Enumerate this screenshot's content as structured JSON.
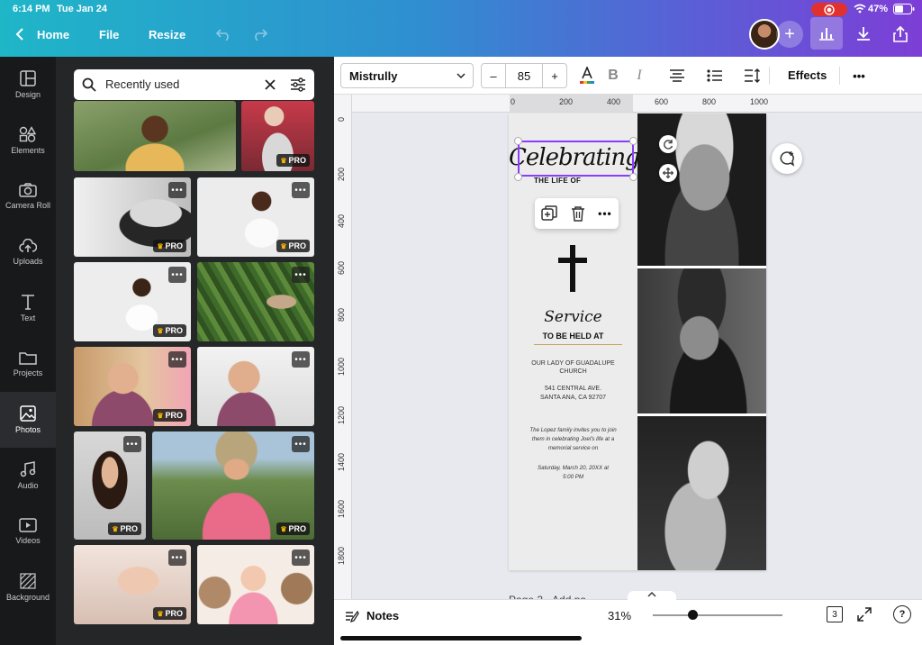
{
  "status_bar": {
    "time": "6:14 PM",
    "date": "Tue Jan 24",
    "battery": "47%"
  },
  "nav": {
    "home": "Home",
    "file": "File",
    "resize": "Resize"
  },
  "rail": {
    "items": [
      {
        "label": "Design",
        "icon": "layout-icon"
      },
      {
        "label": "Elements",
        "icon": "shapes-icon"
      },
      {
        "label": "Camera Roll",
        "icon": "camera-icon"
      },
      {
        "label": "Uploads",
        "icon": "cloud-upload-icon"
      },
      {
        "label": "Text",
        "icon": "text-icon"
      },
      {
        "label": "Projects",
        "icon": "folder-icon"
      },
      {
        "label": "Photos",
        "icon": "image-icon",
        "active": true
      },
      {
        "label": "Audio",
        "icon": "music-icon"
      },
      {
        "label": "Videos",
        "icon": "video-icon"
      },
      {
        "label": "Background",
        "icon": "pattern-icon"
      }
    ]
  },
  "search": {
    "value": "Recently used"
  },
  "photos": {
    "pro_label": "PRO",
    "more_label": "•••"
  },
  "toolbar": {
    "font": "Mistrully",
    "size_minus": "–",
    "font_size": "85",
    "size_plus": "+",
    "bold": "B",
    "italic": "I",
    "effects": "Effects",
    "more": "•••"
  },
  "ruler": {
    "h_ticks": [
      "0",
      "200",
      "400",
      "600",
      "800",
      "1000"
    ],
    "v_ticks": [
      "0",
      "200",
      "400",
      "600",
      "800",
      "1000",
      "1200",
      "1400",
      "1600",
      "1800"
    ]
  },
  "design": {
    "title_script": "Celebrating",
    "subtitle": "THE LIFE OF",
    "service_script": "Service",
    "service_caps": "TO BE HELD AT",
    "church_line1": "OUR LADY OF GUADALUPE",
    "church_line2": "CHURCH",
    "address_line1": "541 CENTRAL AVE.",
    "address_line2": "SANTA ANA, CA 92707",
    "invite_line1": "The Lopez family invites you to join",
    "invite_line2": "them in celebrating Joel's life at a",
    "invite_line3": "memorial service on",
    "date_line1": "Saturday, March 20, 20XX at",
    "date_line2": "5:00 PM"
  },
  "page_label": "Page 2 - Add pa",
  "bottom": {
    "notes": "Notes",
    "zoom": "31%",
    "zoom_level": 0.31,
    "pages": "3",
    "help": "?"
  },
  "colors": {
    "accent": "#8b3dff",
    "rail_bg": "#18191b",
    "panel_bg": "#252627"
  }
}
